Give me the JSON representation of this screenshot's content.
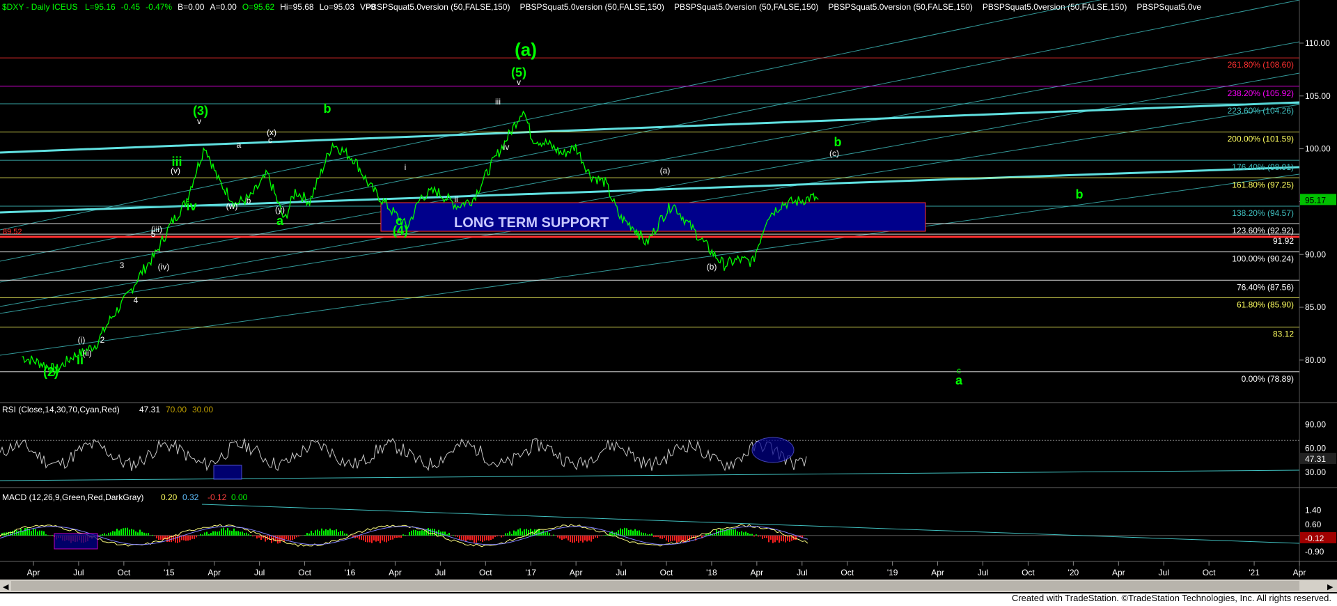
{
  "header": {
    "symbol_text": "$DXY - Daily  ICEUS",
    "ohlc": [
      {
        "label": "L=95.16",
        "color": "#00ff00"
      },
      {
        "label": "-0.45",
        "color": "#00ff00"
      },
      {
        "label": "-0.47%",
        "color": "#00ff00"
      },
      {
        "label": "B=0.00",
        "color": "#ffffff"
      },
      {
        "label": "A=0.00",
        "color": "#ffffff"
      },
      {
        "label": "O=95.62",
        "color": "#00ff00"
      },
      {
        "label": "Hi=95.68",
        "color": "#ffffff"
      },
      {
        "label": "Lo=95.03",
        "color": "#ffffff"
      },
      {
        "label": "V=0",
        "color": "#ffffff"
      }
    ],
    "studies": [
      "PBSPSquat5.0version (50,FALSE,150)",
      "PBSPSquat5.0version (50,FALSE,150)",
      "PBSPSquat5.0version (50,FALSE,150)",
      "PBSPSquat5.0version (50,FALSE,150)",
      "PBSPSquat5.0version (50,FALSE,150)",
      "PBSPSquat5.0ve"
    ]
  },
  "footer": "Created with TradeStation. ©TradeStation Technologies, Inc. All rights reserved.",
  "colors": {
    "background": "#000000",
    "price": "#00ff00",
    "fib_red": "#ff3030",
    "fib_magenta": "#ff00ff",
    "fib_cyan": "#40c0c0",
    "fib_yellow": "#ffff60",
    "channel": "#40c0c0",
    "support_box": "#00008b",
    "wave_green": "#00ff00",
    "wave_white": "#ffffff"
  },
  "chart_data": [
    {
      "type": "line",
      "panel": "price",
      "ylim": [
        76.5,
        112.5
      ],
      "y_ticks": [
        110,
        105,
        100,
        95,
        90,
        85,
        80
      ],
      "x_ticks": [
        "Apr",
        "Jul",
        "Oct",
        "'15",
        "Apr",
        "Jul",
        "Oct",
        "'16",
        "Apr",
        "Jul",
        "Oct",
        "'17",
        "Apr",
        "Jul",
        "Oct",
        "'18",
        "Apr",
        "Jul",
        "Oct",
        "'19",
        "Apr",
        "Jul",
        "Oct",
        "'20",
        "Apr",
        "Jul",
        "Oct",
        "'21",
        "Apr"
      ],
      "last_price_label": "95.17",
      "series": [
        {
          "x": [
            "2014-03-01",
            "2014-04-15",
            "2014-05-10",
            "2014-06-15",
            "2014-07-01",
            "2014-08-01",
            "2014-09-01",
            "2014-10-01",
            "2014-11-01",
            "2014-12-01",
            "2015-01-01",
            "2015-02-01",
            "2015-03-13",
            "2015-04-10",
            "2015-05-15",
            "2015-06-15",
            "2015-07-20",
            "2015-08-24",
            "2015-09-15",
            "2015-10-15",
            "2015-12-01",
            "2016-01-15",
            "2016-02-15",
            "2016-03-15",
            "2016-05-03",
            "2016-06-01",
            "2016-07-01",
            "2016-08-15",
            "2016-09-15",
            "2016-10-25",
            "2016-12-01",
            "2016-12-28",
            "2017-01-15",
            "2017-02-15",
            "2017-03-20",
            "2017-04-15",
            "2017-05-15",
            "2017-06-15",
            "2017-07-15",
            "2017-08-15",
            "2017-09-08",
            "2017-10-10",
            "2017-11-01",
            "2017-12-01",
            "2018-01-15",
            "2018-02-15",
            "2018-03-15",
            "2018-04-15",
            "2018-05-15",
            "2018-06-15",
            "2018-07-15",
            "2018-08-15",
            "2018-08-28"
          ],
          "y": [
            80.3,
            79.6,
            79.0,
            80.4,
            80.6,
            81.5,
            84.0,
            85.8,
            88.2,
            90.0,
            92.8,
            94.9,
            100.3,
            97.0,
            94.8,
            95.4,
            97.6,
            93.2,
            96.0,
            95.0,
            100.5,
            99.0,
            96.5,
            95.0,
            92.6,
            95.5,
            96.0,
            94.6,
            95.2,
            98.6,
            101.5,
            103.8,
            101.0,
            100.5,
            99.5,
            100.2,
            97.5,
            96.8,
            93.5,
            92.5,
            91.0,
            93.5,
            94.8,
            93.0,
            90.5,
            89.0,
            89.5,
            89.3,
            93.6,
            94.8,
            95.0,
            95.4,
            95.2
          ]
        }
      ]
    },
    {
      "type": "line",
      "panel": "rsi",
      "title": "RSI (Close,14,30,70,Cyan,Red)",
      "values_text": [
        "47.31",
        "70.00",
        "30.00"
      ],
      "y_ticks": [
        90,
        60,
        30
      ],
      "current": 47.31
    },
    {
      "type": "line",
      "panel": "macd",
      "title": "MACD (12,26,9,Green,Red,DarkGray)",
      "values_text": [
        "0.20",
        "0.32",
        "-0.12",
        "0.00"
      ],
      "y_ticks": [
        1.4,
        0.6,
        -0.9
      ],
      "current": -0.12
    }
  ],
  "fib_levels": [
    {
      "label": "261.80% (108.60)",
      "value": 108.6,
      "color": "#ff3030"
    },
    {
      "label": "238.20% (105.92)",
      "value": 105.92,
      "color": "#ff00ff"
    },
    {
      "label": "223.60% (104.26)",
      "value": 104.26,
      "color": "#40c0c0"
    },
    {
      "label": "200.00% (101.59)",
      "value": 101.59,
      "color": "#ffff60"
    },
    {
      "label": "176.40% (98.91)",
      "value": 98.91,
      "color": "#40c0c0"
    },
    {
      "label": "161.80% (97.25)",
      "value": 97.25,
      "color": "#ffff60"
    },
    {
      "label": "138.20% (94.57)",
      "value": 94.57,
      "color": "#40c0c0"
    },
    {
      "label": "123.60% (92.92)",
      "value": 92.92,
      "color": "#ffffff"
    },
    {
      "label": "91.92",
      "value": 91.92,
      "color": "#ffffff"
    },
    {
      "label": "100.00% (90.24)",
      "value": 90.24,
      "color": "#ffffff"
    },
    {
      "label": "76.40% (87.56)",
      "value": 87.56,
      "color": "#ffffff"
    },
    {
      "label": "61.80% (85.90)",
      "value": 85.9,
      "color": "#ffff60"
    },
    {
      "label": "83.12",
      "value": 83.12,
      "color": "#ffff60"
    },
    {
      "label": "0.00% (78.89)",
      "value": 78.89,
      "color": "#ffffff"
    }
  ],
  "left_level_label": "89.52",
  "support_label": "LONG TERM SUPPORT",
  "wave_labels": [
    {
      "text": "(a)",
      "color": "#00ff00",
      "size": "big"
    },
    {
      "text": "(5)",
      "color": "#00ff00",
      "size": "mid"
    },
    {
      "text": "(3)",
      "color": "#00ff00",
      "size": "mid"
    },
    {
      "text": "(4)",
      "color": "#00ff00",
      "size": "mid"
    },
    {
      "text": "(2)",
      "color": "#00ff00",
      "size": "mid"
    },
    {
      "text": "b",
      "color": "#00ff00",
      "size": "mid"
    },
    {
      "text": "b",
      "color": "#00ff00",
      "size": "mid"
    },
    {
      "text": "b",
      "color": "#00ff00",
      "size": "mid"
    },
    {
      "text": "c",
      "color": "#00ff00",
      "size": "mid"
    },
    {
      "text": "a",
      "color": "#00ff00",
      "size": "mid"
    },
    {
      "text": "a",
      "color": "#00ff00",
      "size": "mid"
    },
    {
      "text": "c",
      "color": "#00ff00",
      "size": "small"
    },
    {
      "text": "iii",
      "color": "#00ff00",
      "size": "mid"
    },
    {
      "text": "iv",
      "color": "#00ff00",
      "size": "mid"
    },
    {
      "text": "ii",
      "color": "#00ff00",
      "size": "mid"
    },
    {
      "text": "a",
      "color": "#00ff00",
      "size": "small"
    },
    {
      "text": "v",
      "color": "#ffffff",
      "size": "small"
    },
    {
      "text": "iii",
      "color": "#ffffff",
      "size": "small"
    },
    {
      "text": "iv",
      "color": "#ffffff",
      "size": "small"
    },
    {
      "text": "i",
      "color": "#ffffff",
      "size": "small"
    },
    {
      "text": "ii",
      "color": "#ffffff",
      "size": "small"
    },
    {
      "text": "(a)",
      "color": "#ffffff",
      "size": "small"
    },
    {
      "text": "(b)",
      "color": "#ffffff",
      "size": "small"
    },
    {
      "text": "(c)",
      "color": "#ffffff",
      "size": "small"
    },
    {
      "text": "(x)",
      "color": "#ffffff",
      "size": "small"
    },
    {
      "text": "(w)",
      "color": "#ffffff",
      "size": "small"
    },
    {
      "text": "(y)",
      "color": "#ffffff",
      "size": "small"
    },
    {
      "text": "(v)",
      "color": "#ffffff",
      "size": "small"
    },
    {
      "text": "(iii)",
      "color": "#ffffff",
      "size": "small"
    },
    {
      "text": "(iv)",
      "color": "#ffffff",
      "size": "small"
    },
    {
      "text": "(i)",
      "color": "#ffffff",
      "size": "small"
    },
    {
      "text": "(ii)",
      "color": "#ffffff",
      "size": "small"
    },
    {
      "text": "a",
      "color": "#ffffff",
      "size": "small"
    },
    {
      "text": "b",
      "color": "#ffffff",
      "size": "small"
    },
    {
      "text": "c",
      "color": "#ffffff",
      "size": "small"
    },
    {
      "text": "v",
      "color": "#ffffff",
      "size": "small"
    },
    {
      "text": "3",
      "color": "#ffffff",
      "size": "small"
    },
    {
      "text": "4",
      "color": "#ffffff",
      "size": "small"
    },
    {
      "text": "5",
      "color": "#ffffff",
      "size": "small"
    },
    {
      "text": "2",
      "color": "#ffffff",
      "size": "small"
    }
  ]
}
